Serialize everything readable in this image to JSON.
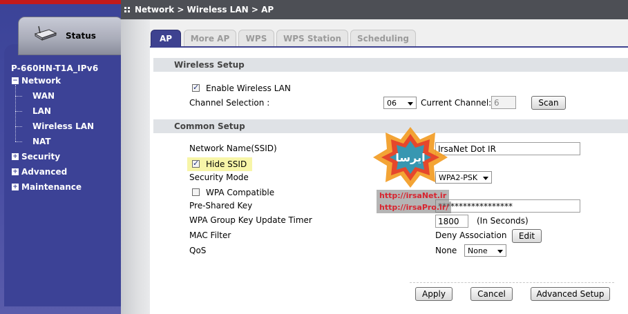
{
  "sidebar": {
    "status_label": "Status",
    "device_name": "P-660HN-T1A_IPv6",
    "nav": [
      {
        "label": "Network",
        "expanded": true,
        "children": [
          "WAN",
          "LAN",
          "Wireless LAN",
          "NAT"
        ]
      },
      {
        "label": "Security",
        "expanded": false
      },
      {
        "label": "Advanced",
        "expanded": false
      },
      {
        "label": "Maintenance",
        "expanded": false
      }
    ]
  },
  "header": {
    "breadcrumb": "Network > Wireless LAN > AP"
  },
  "tabs": [
    {
      "label": "AP",
      "active": true
    },
    {
      "label": "More AP",
      "active": false
    },
    {
      "label": "WPS",
      "active": false
    },
    {
      "label": "WPS Station",
      "active": false
    },
    {
      "label": "Scheduling",
      "active": false
    }
  ],
  "wireless_setup": {
    "title": "Wireless Setup",
    "enable_label": "Enable Wireless LAN",
    "enable_checked": true,
    "channel_label": "Channel Selection :",
    "channel_value": "06",
    "current_channel_label": "Current Channel:",
    "current_channel_value": "6",
    "scan_button": "Scan"
  },
  "common_setup": {
    "title": "Common Setup",
    "ssid_label": "Network Name(SSID)",
    "ssid_value": "IrsaNet Dot IR",
    "hide_ssid_label": "Hide SSID",
    "hide_ssid_checked": true,
    "security_mode_label": "Security Mode",
    "security_mode_value": "WPA2-PSK",
    "wpa_compat_label": "WPA Compatible",
    "wpa_compat_checked": false,
    "psk_label": "Pre-Shared Key",
    "psk_value": "******************",
    "group_key_label": "WPA Group Key Update Timer",
    "group_key_value": "1800",
    "group_key_unit": "(In Seconds)",
    "mac_filter_label": "MAC Filter",
    "mac_filter_value": "Deny Association",
    "mac_edit_button": "Edit",
    "qos_label": "QoS",
    "qos_value": "None",
    "qos_select_value": "None"
  },
  "footer_buttons": {
    "apply": "Apply",
    "cancel": "Cancel",
    "advanced": "Advanced Setup"
  },
  "watermark": {
    "url1": "http://irsaNet.ir",
    "url2": "http://irsaPro.ir/",
    "logo_text": "ایرسا"
  },
  "colors": {
    "sidebar": "#3c4296",
    "top_red": "#c21a1a",
    "header_bar": "#4d4f55",
    "active_tab": "#3e4290",
    "section_bg": "#dfe2e6",
    "highlight": "#f7f5a8"
  }
}
